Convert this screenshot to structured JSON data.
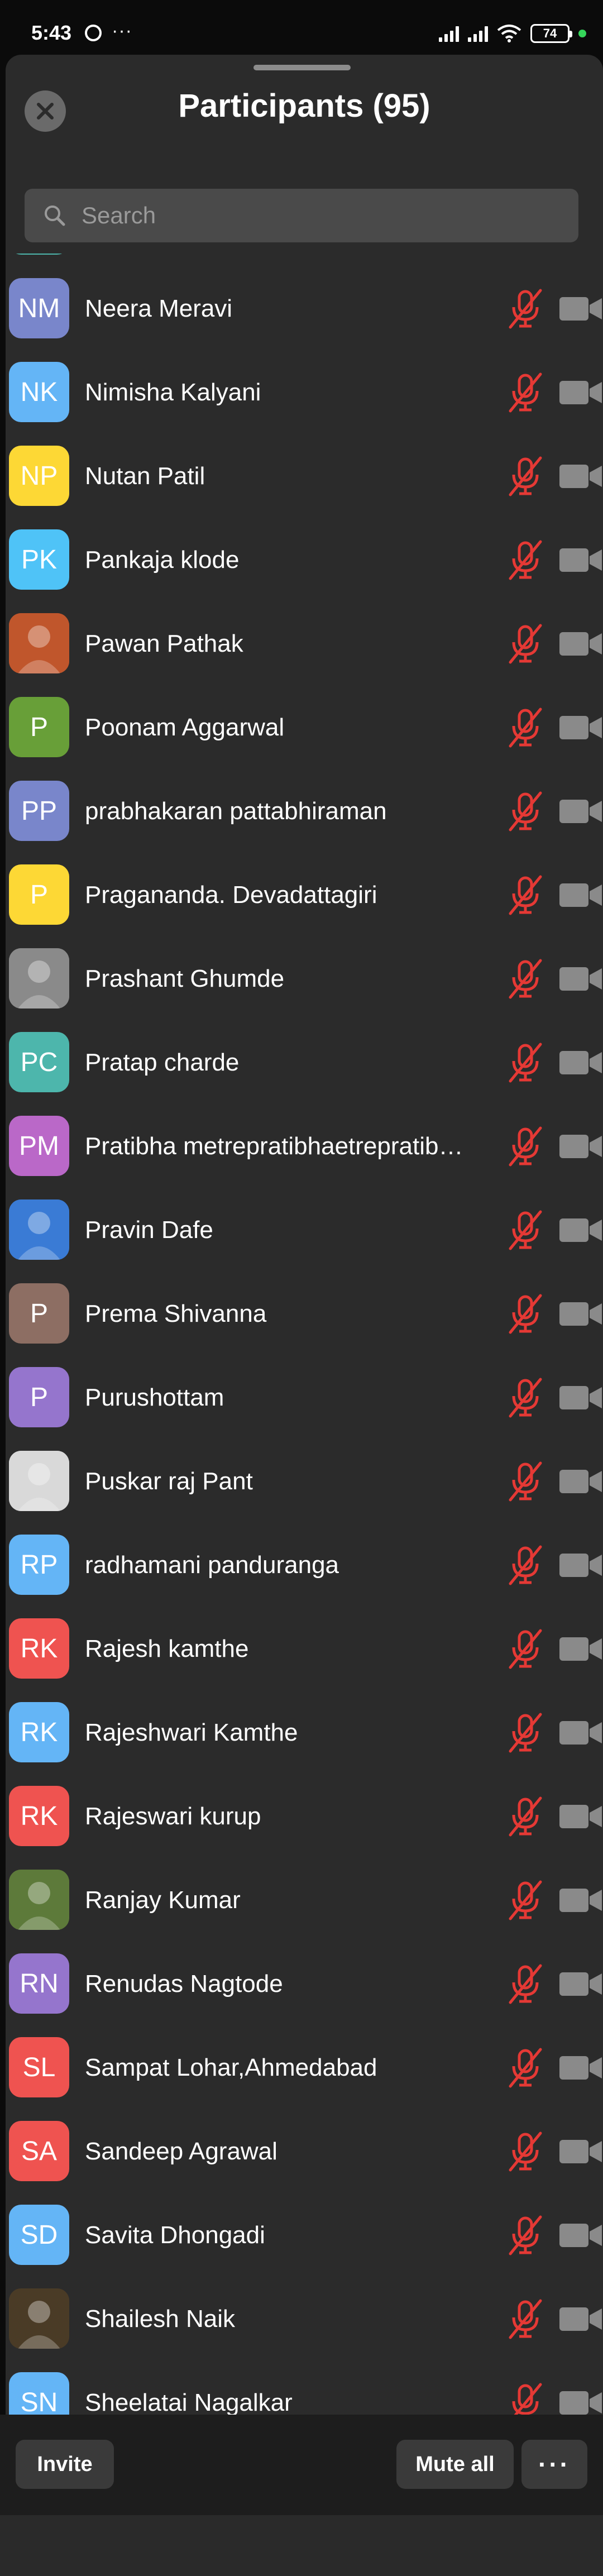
{
  "status_bar": {
    "time": "5:43",
    "notif_dots": "···",
    "battery": "74"
  },
  "header": {
    "title": "Participants (95)"
  },
  "search": {
    "placeholder": "Search",
    "value": ""
  },
  "participants": [
    {
      "initials": "",
      "name": "",
      "color": "#4db6ac",
      "photo": false
    },
    {
      "initials": "NM",
      "name": "Neera Meravi",
      "color": "#7986cb",
      "photo": false
    },
    {
      "initials": "NK",
      "name": "Nimisha Kalyani",
      "color": "#64b5f6",
      "photo": false
    },
    {
      "initials": "NP",
      "name": "Nutan Patil",
      "color": "#fdd835",
      "photo": false
    },
    {
      "initials": "PK",
      "name": "Pankaja klode",
      "color": "#4fc3f7",
      "photo": false
    },
    {
      "initials": "",
      "name": "Pawan Pathak",
      "color": "#c0562c",
      "photo": true
    },
    {
      "initials": "P",
      "name": "Poonam Aggarwal",
      "color": "#689f38",
      "photo": false
    },
    {
      "initials": "PP",
      "name": "prabhakaran pattabhiraman",
      "color": "#7986cb",
      "photo": false
    },
    {
      "initials": "P",
      "name": "Pragananda.   Devadattagiri",
      "color": "#fdd835",
      "photo": false
    },
    {
      "initials": "",
      "name": "Prashant Ghumde",
      "color": "#8a8a8a",
      "photo": true
    },
    {
      "initials": "PC",
      "name": "Pratap charde",
      "color": "#4db6ac",
      "photo": false
    },
    {
      "initials": "PM",
      "name": "Pratibha metrepratibhaetrepratibha",
      "color": "#ba68c8",
      "photo": false
    },
    {
      "initials": "",
      "name": "Pravin Dafe",
      "color": "#3a7bd5",
      "photo": true
    },
    {
      "initials": "P",
      "name": "Prema Shivanna",
      "color": "#8d6e63",
      "photo": false
    },
    {
      "initials": "P",
      "name": "Purushottam",
      "color": "#9575cd",
      "photo": false
    },
    {
      "initials": "",
      "name": "Puskar raj Pant",
      "color": "#d9d9d9",
      "photo": true
    },
    {
      "initials": "RP",
      "name": "radhamani panduranga",
      "color": "#64b5f6",
      "photo": false
    },
    {
      "initials": "RK",
      "name": "Rajesh kamthe",
      "color": "#ef5350",
      "photo": false
    },
    {
      "initials": "RK",
      "name": "Rajeshwari Kamthe",
      "color": "#64b5f6",
      "photo": false
    },
    {
      "initials": "RK",
      "name": "Rajeswari kurup",
      "color": "#ef5350",
      "photo": false
    },
    {
      "initials": "",
      "name": "Ranjay Kumar",
      "color": "#5d7a3a",
      "photo": true
    },
    {
      "initials": "RN",
      "name": "Renudas Nagtode",
      "color": "#9575cd",
      "photo": false
    },
    {
      "initials": "SL",
      "name": "Sampat Lohar,Ahmedabad",
      "color": "#ef5350",
      "photo": false
    },
    {
      "initials": "SA",
      "name": "Sandeep Agrawal",
      "color": "#ef5350",
      "photo": false
    },
    {
      "initials": "SD",
      "name": "Savita Dhongadi",
      "color": "#64b5f6",
      "photo": false
    },
    {
      "initials": "",
      "name": "Shailesh Naik",
      "color": "#4a3b26",
      "photo": true
    },
    {
      "initials": "SN",
      "name": "Sheelatai Nagalkar",
      "color": "#64b5f6",
      "photo": false
    }
  ],
  "footer": {
    "invite_label": "Invite",
    "mute_all_label": "Mute all",
    "more_label": "···"
  },
  "colors": {
    "sheet_bg": "#2b2b2b",
    "muted_red": "#e53935",
    "camera_gray": "#8a8a8a"
  }
}
